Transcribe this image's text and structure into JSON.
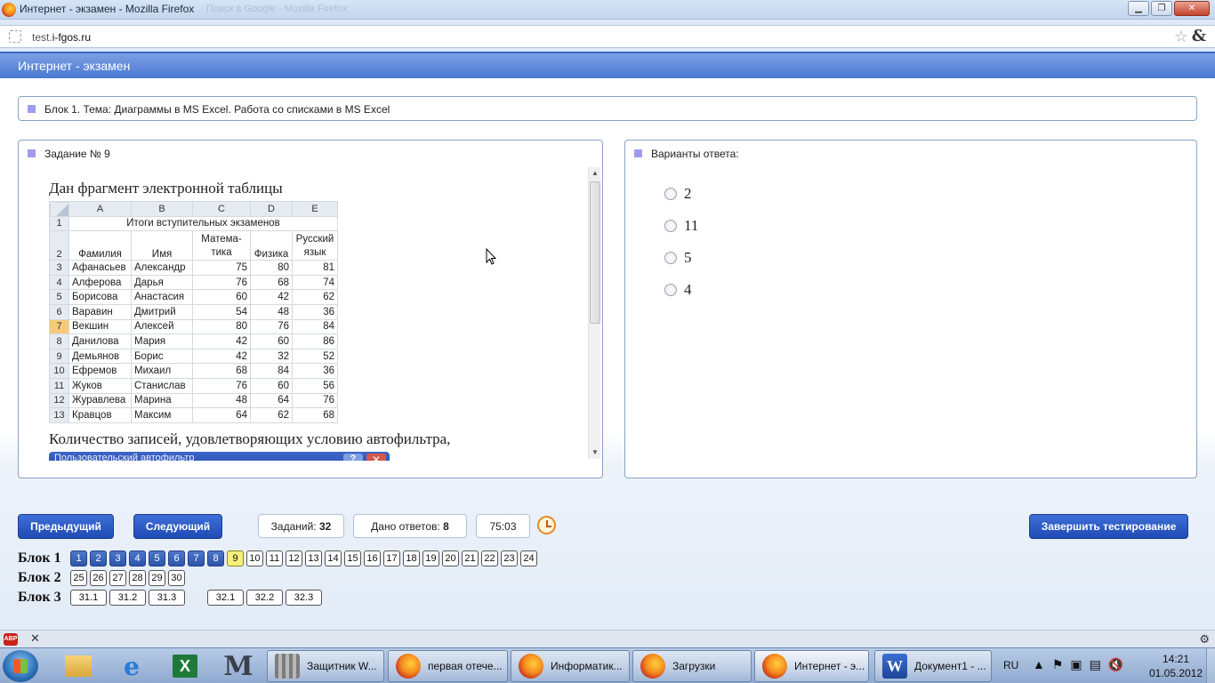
{
  "window": {
    "title": "Интернет - экзамен - Mozilla Firefox",
    "ghost_tab": "Поиск в Google - Mozilla Firefox",
    "minimize": "▁",
    "maximize": "❐",
    "close": "✕"
  },
  "address": {
    "url_prefix": "test.",
    "url_domain": "i-fgos.ru",
    "star": "☆",
    "amp": "&"
  },
  "page": {
    "header": "Интернет - экзамен",
    "block_title": "Блок 1. Тема: Диаграммы в MS Excel. Работа со списками в MS Excel",
    "task_title": "Задание № 9",
    "answers_title": "Варианты ответа:"
  },
  "task": {
    "intro": "Дан фрагмент электронной таблицы",
    "question": "Количество записей, удовлетворяющих условию автофильтра,",
    "dialog_strip_text": "Пользовательский автофильтр",
    "dialog_help": "?",
    "dialog_close": "✕"
  },
  "sheet": {
    "columns": [
      "A",
      "B",
      "C",
      "D",
      "E"
    ],
    "merged_title": "Итоги вступительных экзаменов",
    "headers": [
      "Фамилия",
      "Имя",
      "Матема-тика",
      "Физика",
      "Русский язык"
    ],
    "rows": [
      {
        "n": "3",
        "cells": [
          "Афанасьев",
          "Александр",
          "75",
          "80",
          "81"
        ]
      },
      {
        "n": "4",
        "cells": [
          "Алферова",
          "Дарья",
          "76",
          "68",
          "74"
        ]
      },
      {
        "n": "5",
        "cells": [
          "Борисова",
          "Анастасия",
          "60",
          "42",
          "62"
        ]
      },
      {
        "n": "6",
        "cells": [
          "Варавин",
          "Дмитрий",
          "54",
          "48",
          "36"
        ]
      },
      {
        "n": "7",
        "cells": [
          "Векшин",
          "Алексей",
          "80",
          "76",
          "84"
        ]
      },
      {
        "n": "8",
        "cells": [
          "Данилова",
          "Мария",
          "42",
          "60",
          "86"
        ]
      },
      {
        "n": "9",
        "cells": [
          "Демьянов",
          "Борис",
          "42",
          "32",
          "52"
        ]
      },
      {
        "n": "10",
        "cells": [
          "Ефремов",
          "Михаил",
          "68",
          "84",
          "36"
        ]
      },
      {
        "n": "11",
        "cells": [
          "Жуков",
          "Станислав",
          "76",
          "60",
          "56"
        ]
      },
      {
        "n": "12",
        "cells": [
          "Журавлева",
          "Марина",
          "48",
          "64",
          "76"
        ]
      },
      {
        "n": "13",
        "cells": [
          "Кравцов",
          "Максим",
          "64",
          "62",
          "68"
        ]
      }
    ]
  },
  "answers": [
    "2",
    "11",
    "5",
    "4"
  ],
  "controls": {
    "prev": "Предыдущий",
    "next": "Следующий",
    "tasks_label": "Заданий:",
    "tasks_count": "32",
    "answered_label": "Дано ответов:",
    "answered_count": "8",
    "timer": "75:03",
    "finish": "Завершить тестирование"
  },
  "navigator": {
    "block1_label": "Блок 1",
    "block2_label": "Блок 2",
    "block3_label": "Блок 3",
    "block1": [
      "1",
      "2",
      "3",
      "4",
      "5",
      "6",
      "7",
      "8",
      "9",
      "10",
      "11",
      "12",
      "13",
      "14",
      "15",
      "16",
      "17",
      "18",
      "19",
      "20",
      "21",
      "22",
      "23",
      "24"
    ],
    "block1_answered": 8,
    "block1_current": "9",
    "block2": [
      "25",
      "26",
      "27",
      "28",
      "29",
      "30"
    ],
    "block3a": [
      "31.1",
      "31.2",
      "31.3"
    ],
    "block3b": [
      "32.1",
      "32.2",
      "32.3"
    ]
  },
  "addonbar": {
    "abp": "ABP",
    "close": "✕",
    "gear": "⚙"
  },
  "taskbar": {
    "items": [
      "Защитник W...",
      "первая отече...",
      "Информатик...",
      "Загрузки",
      "Интернет - э...",
      "Документ1 - ..."
    ],
    "pinned_excel": "X",
    "pinned_m": "M",
    "pinned_ie": "e",
    "word_glyph": "W",
    "lang": "RU",
    "time": "14:21",
    "date": "01.05.2012"
  },
  "colors": {
    "header_blue": "#4b78d2",
    "button_blue": "#1f4bb5",
    "current_yellow": "#f6f07a",
    "bullet_violet": "#9f9cf0"
  }
}
